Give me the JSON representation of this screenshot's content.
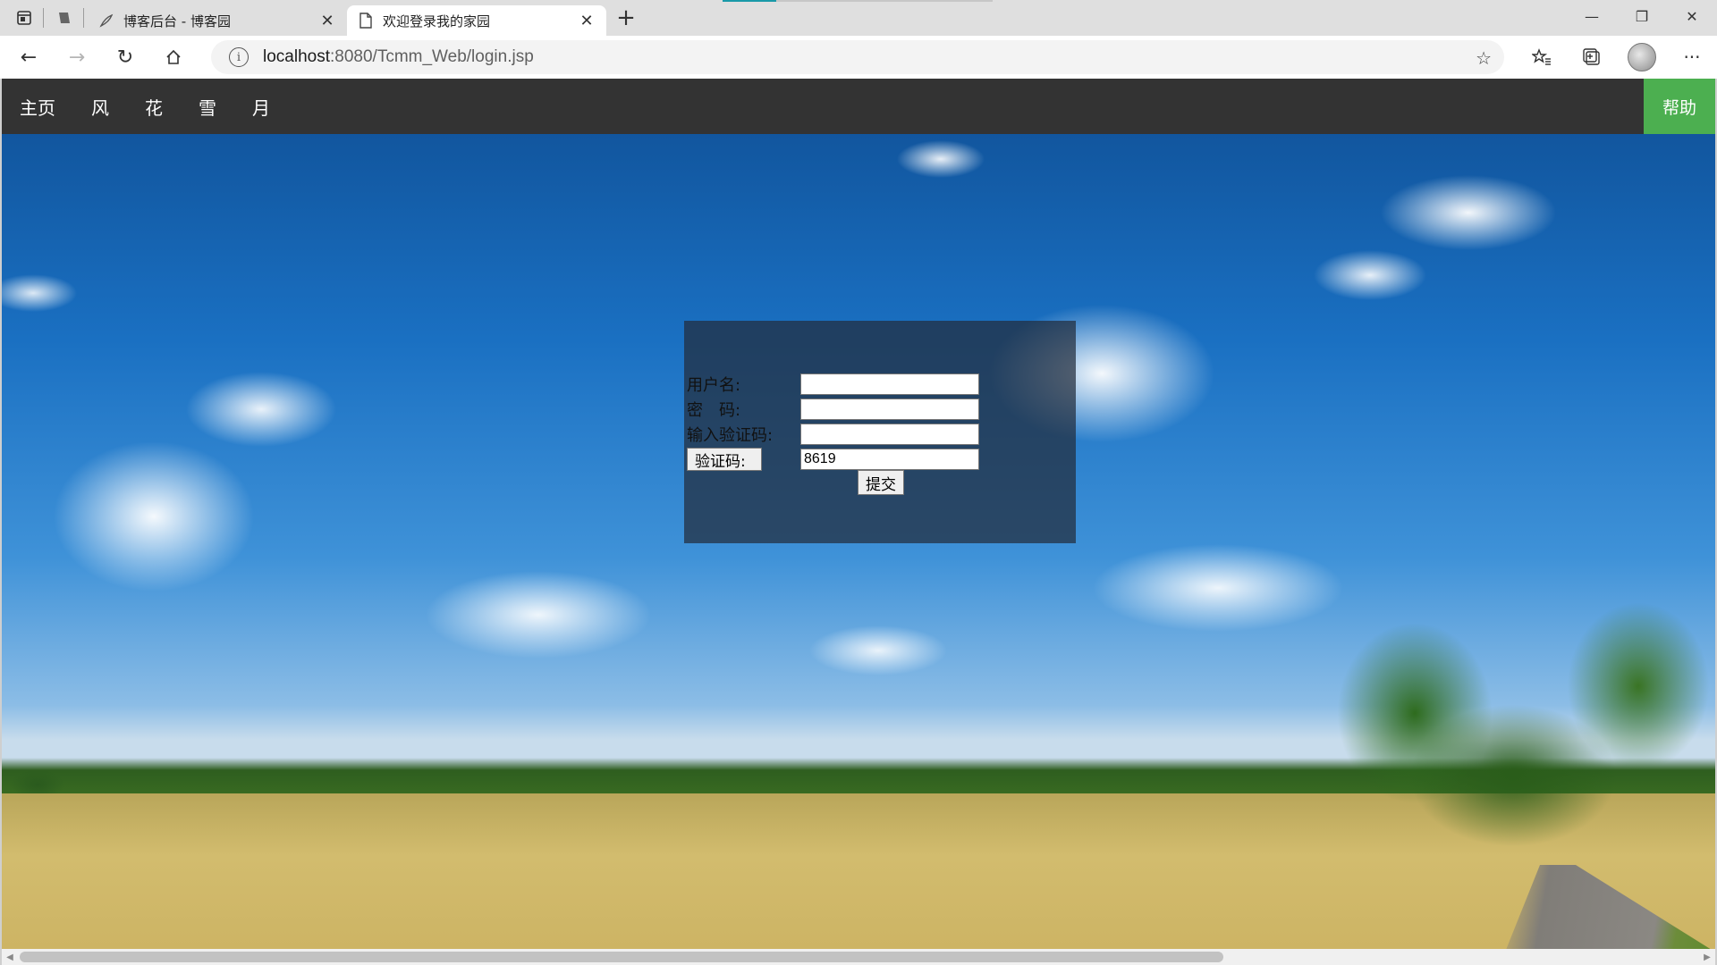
{
  "browser": {
    "tabs": [
      {
        "title": "博客后台 - 博客园",
        "active": false,
        "icon": "feather-icon"
      },
      {
        "title": "欢迎登录我的家园",
        "active": true,
        "icon": "page-icon"
      }
    ],
    "url_host": "localhost",
    "url_path": ":8080/Tcmm_Web/login.jsp"
  },
  "site_nav": {
    "items": [
      "主页",
      "风",
      "花",
      "雪",
      "月"
    ],
    "help": "帮助",
    "help_color": "#4caf50",
    "bar_color": "#333333"
  },
  "login": {
    "username_label": "用户名:",
    "username_value": "",
    "password_label": "密　码:",
    "password_value": "",
    "captcha_input_label": "输入验证码:",
    "captcha_input_value": "",
    "captcha_button": "验证码:",
    "captcha_value": "8619",
    "submit": "提交"
  }
}
